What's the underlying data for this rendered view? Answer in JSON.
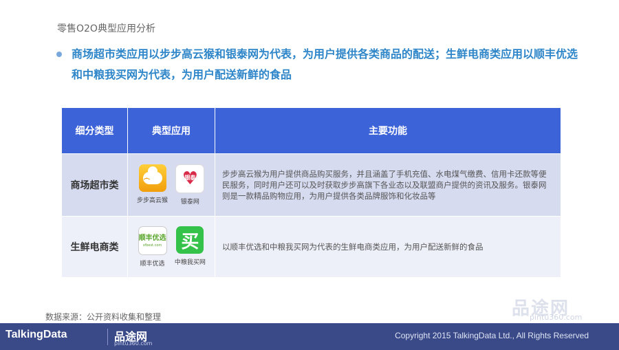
{
  "header": {
    "subtitle": "零售O2O典型应用分析",
    "headline": "商场超市类应用以步步高云猴和银泰网为代表，为用户提供各类商品的配送；生鲜电商类应用以顺丰优选和中粮我买网为代表，为用户配送新鲜的食品"
  },
  "table": {
    "headers": [
      "细分类型",
      "典型应用",
      "主要功能"
    ],
    "rows": [
      {
        "category": "商场超市类",
        "apps": [
          {
            "name": "步步高云猴",
            "icon": "bubugao-yunhou-icon",
            "icon_text": "☁"
          },
          {
            "name": "银泰网",
            "icon": "yintai-icon",
            "icon_text": "银泰"
          }
        ],
        "function": "步步高云猴为用户提供商品购买服务，并且涵盖了手机充值、水电煤气缴费、信用卡还款等便民服务，同时用户还可以及时获取步步高旗下各业态以及联盟商户提供的资讯及服务。银泰网则是一款精品购物应用，为用户提供各类品牌服饰和化妆品等"
      },
      {
        "category": "生鲜电商类",
        "apps": [
          {
            "name": "顺丰优选",
            "icon": "sf-best-icon",
            "icon_text": "顺丰优选",
            "icon_sub": "sfbest.com"
          },
          {
            "name": "中粮我买网",
            "icon": "womai-icon",
            "icon_text": "买"
          }
        ],
        "function": "以顺丰优选和中粮我买网为代表的生鲜电商类应用，为用户配送新鲜的食品"
      }
    ]
  },
  "source": "数据来源：公开资料收集和整理",
  "footer": {
    "logo": "TalkingData",
    "partner_logo": "品途网",
    "partner_url": "pintu360.com",
    "copyright": "Copyright 2015 TalkingData Ltd., All Rights Reserved"
  },
  "watermark": {
    "text": "品途网",
    "url": "pintu360.com"
  },
  "colors": {
    "headline": "#2e86c9",
    "table_header": "#3d63d9",
    "row1": "#d6dbf0",
    "row2": "#eef0f9",
    "footer": "#3a4a88"
  }
}
